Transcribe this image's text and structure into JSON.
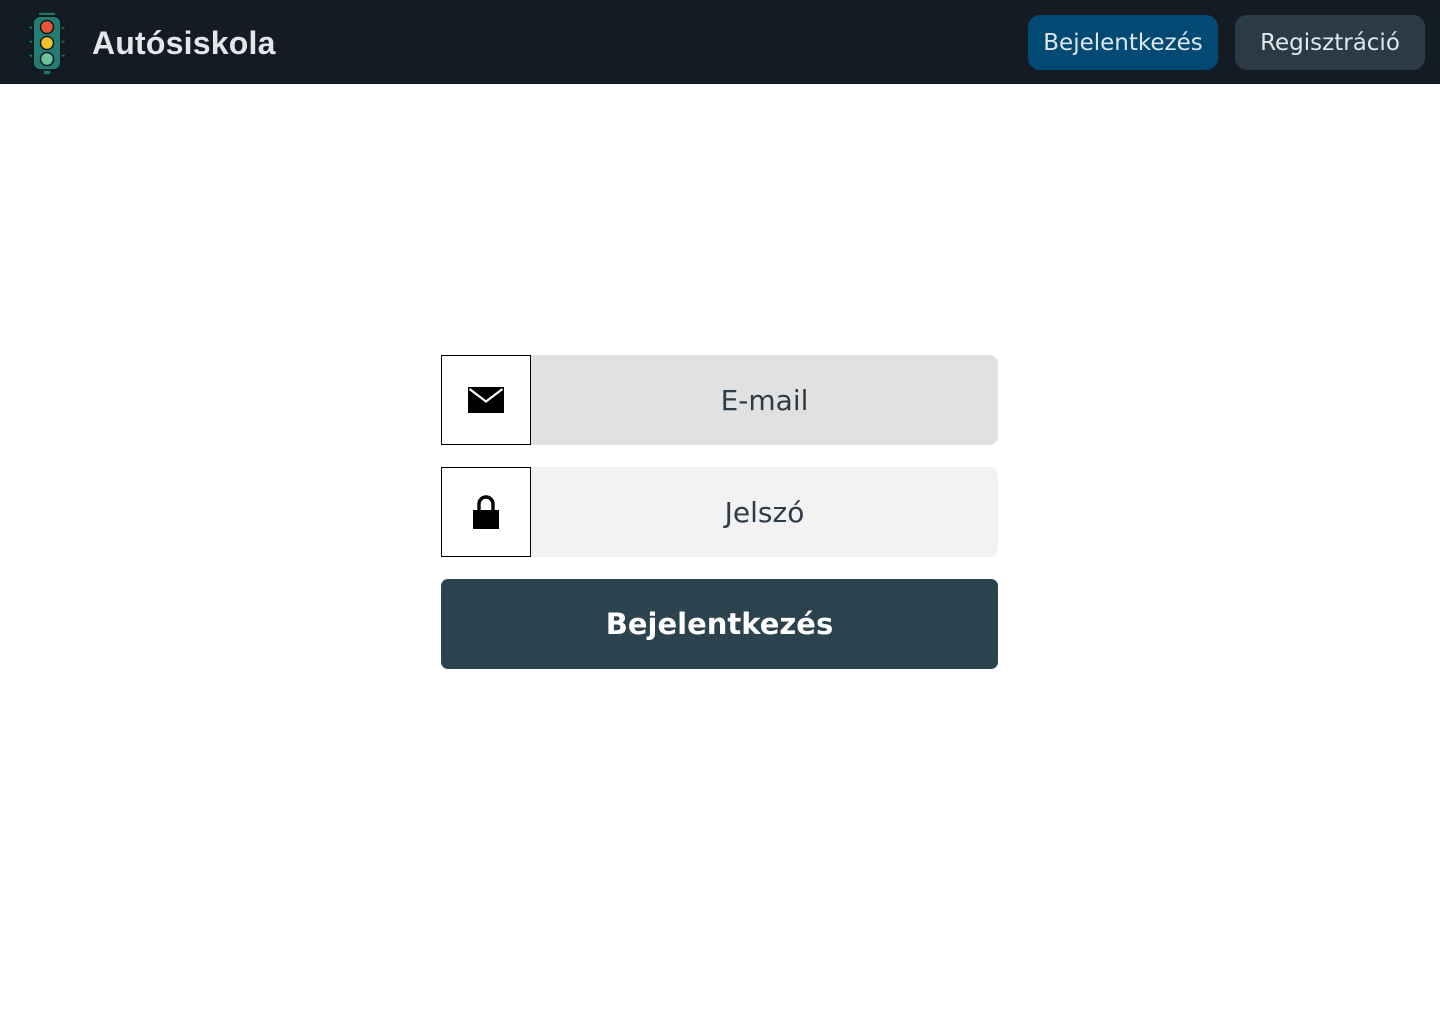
{
  "app": {
    "title": "Autósiskola",
    "logo_icon": "traffic-light-icon"
  },
  "nav": {
    "login_label": "Bejelentkezés",
    "register_label": "Regisztráció"
  },
  "login_form": {
    "email_placeholder": "E-mail",
    "email_icon": "envelope-icon",
    "password_placeholder": "Jelszó",
    "password_icon": "lock-icon",
    "submit_label": "Bejelentkezés"
  },
  "colors": {
    "topbar_bg": "#141b23",
    "login_nav_bg": "#024a73",
    "register_nav_bg": "#2c3a45",
    "submit_bg": "#2d424f",
    "email_field_bg": "#e1e1e1",
    "password_field_bg": "#f2f2f2"
  }
}
